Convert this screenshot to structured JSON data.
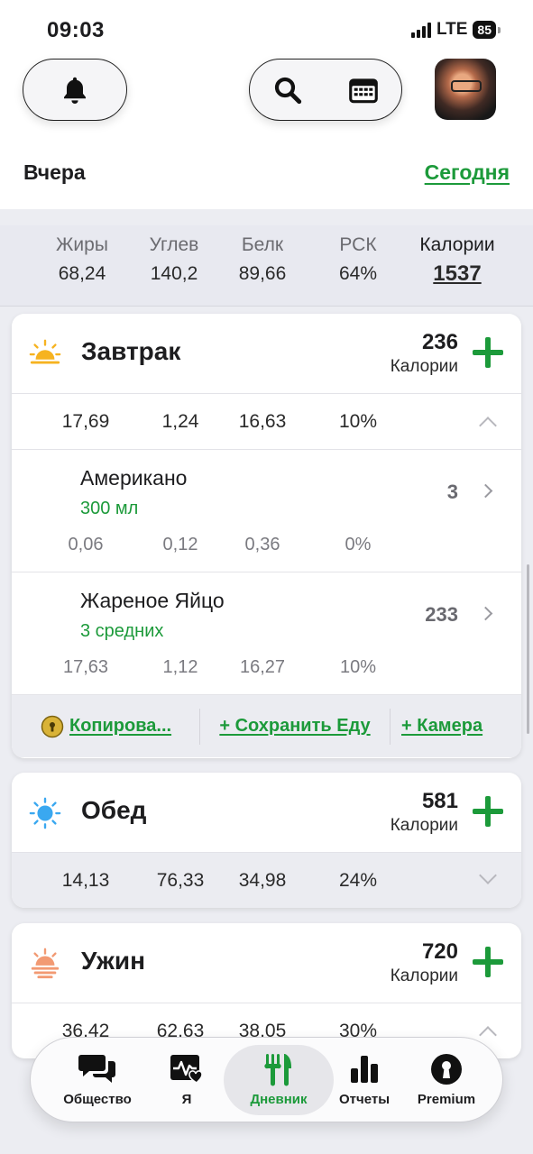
{
  "status": {
    "time": "09:03",
    "network": "LTE",
    "battery": "85"
  },
  "header": {
    "prev_day": "Вчера",
    "today": "Сегодня"
  },
  "summary": {
    "cols": [
      {
        "label": "Жиры",
        "value": "68,24"
      },
      {
        "label": "Углев",
        "value": "140,2"
      },
      {
        "label": "Белк",
        "value": "89,66"
      },
      {
        "label": "РСК",
        "value": "64%"
      },
      {
        "label": "Калории",
        "value": "1537"
      }
    ]
  },
  "breakfast": {
    "name": "Завтрак",
    "calories": "236",
    "unit": "Калории",
    "macros": [
      "17,69",
      "1,24",
      "16,63",
      "10%"
    ],
    "foods": [
      {
        "name": "Американо",
        "qty": "300 мл",
        "calories": "3",
        "macros": [
          "0,06",
          "0,12",
          "0,36",
          "0%"
        ]
      },
      {
        "name": "Жареное Яйцо",
        "qty": "3 средних",
        "calories": "233",
        "macros": [
          "17,63",
          "1,12",
          "16,27",
          "10%"
        ]
      }
    ],
    "actions": {
      "copy": "Копирова...",
      "save": "+ Сохранить Еду",
      "camera": "+ Камера"
    }
  },
  "lunch": {
    "name": "Обед",
    "calories": "581",
    "unit": "Калории",
    "macros": [
      "14,13",
      "76,33",
      "34,98",
      "24%"
    ]
  },
  "dinner": {
    "name": "Ужин",
    "calories": "720",
    "unit": "Калории",
    "macros": [
      "36,42",
      "62,63",
      "38,05",
      "30%"
    ]
  },
  "tabs": [
    {
      "label": "Общество",
      "icon": "chat-bubbles-icon"
    },
    {
      "label": "Я",
      "icon": "health-heart-icon"
    },
    {
      "label": "Дневник",
      "icon": "fork-knife-icon"
    },
    {
      "label": "Отчеты",
      "icon": "bar-chart-icon"
    },
    {
      "label": "Premium",
      "icon": "keyhole-icon"
    }
  ],
  "colors": {
    "accent": "#1c9a3a",
    "breakfast_icon": "#f6b320",
    "lunch_icon": "#3aa8f0",
    "dinner_icon": "#f29a73"
  }
}
